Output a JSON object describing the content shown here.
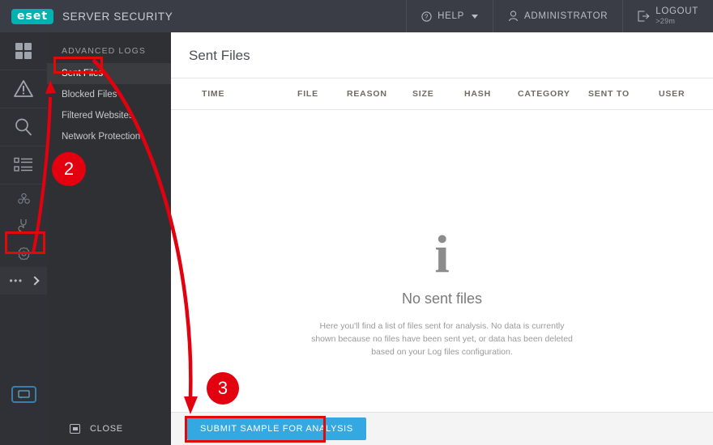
{
  "header": {
    "logo_text": "eset",
    "product_title": "SERVER SECURITY",
    "help_label": "HELP",
    "user_label": "ADMINISTRATOR",
    "logout_label": "LOGOUT",
    "logout_timer": ">29m"
  },
  "rail": {
    "icons": [
      {
        "name": "dashboard-icon"
      },
      {
        "name": "warning-icon"
      },
      {
        "name": "search-icon"
      },
      {
        "name": "logs-icon"
      },
      {
        "name": "biohazard-icon"
      },
      {
        "name": "tools-icon"
      },
      {
        "name": "gear-icon"
      }
    ],
    "expand_dots": "•••",
    "monitor_icon": "monitor-chat-icon"
  },
  "sidebar": {
    "section_title": "ADVANCED LOGS",
    "items": [
      {
        "label": "Sent Files",
        "active": true
      },
      {
        "label": "Blocked Files",
        "active": false
      },
      {
        "label": "Filtered Websites",
        "active": false
      },
      {
        "label": "Network Protection",
        "active": false
      }
    ],
    "close_label": "CLOSE"
  },
  "main": {
    "page_title": "Sent Files",
    "columns": [
      "TIME",
      "FILE",
      "REASON",
      "SIZE",
      "HASH",
      "CATEGORY",
      "SENT TO",
      "USER"
    ],
    "empty_icon": "i",
    "empty_title": "No sent files",
    "empty_description": "Here you'll find a list of files sent for analysis. No data is currently shown because no files have been sent yet, or data has been deleted based on your Log files configuration.",
    "submit_label": "SUBMIT SAMPLE FOR ANALYSIS"
  },
  "annotations": {
    "markers": [
      {
        "label": "2"
      },
      {
        "label": "3"
      }
    ],
    "highlight_color": "#e00a0a"
  },
  "colors": {
    "brand_teal": "#00b3b0",
    "accent_blue": "#34a8e0",
    "header_bg": "#3a3d46",
    "rail_bg": "#2f3136",
    "panel_bg": "#2f3033",
    "annotation_red": "#e3000f"
  }
}
